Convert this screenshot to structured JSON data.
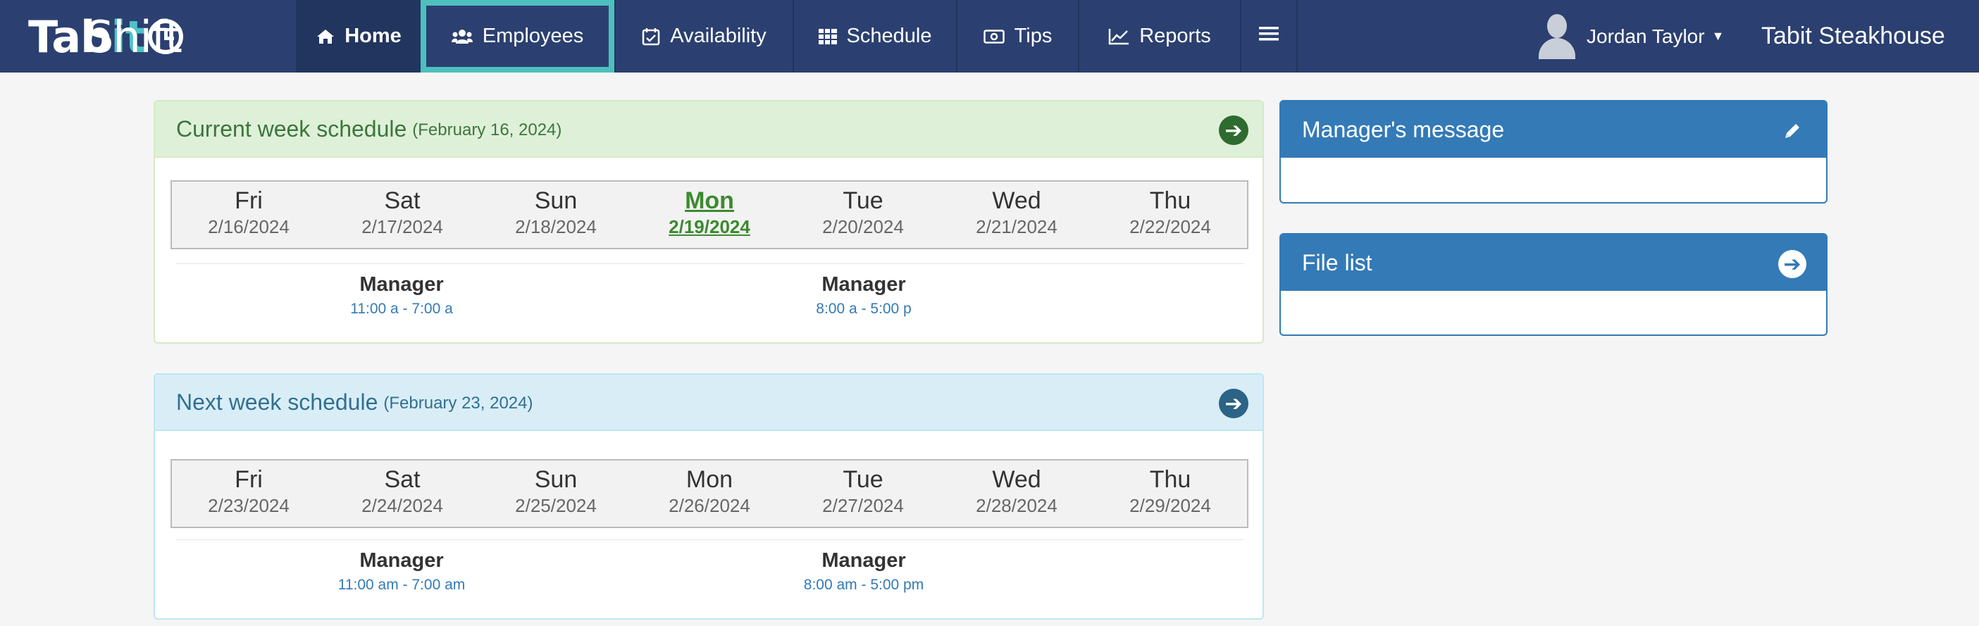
{
  "nav": {
    "logo": {
      "tabit_a": "Tab",
      "tabit_b": "it",
      "shift": "Shift"
    },
    "items": [
      {
        "label": "Home",
        "icon": "home-icon"
      },
      {
        "label": "Employees",
        "icon": "users-icon"
      },
      {
        "label": "Availability",
        "icon": "calendar-check-icon"
      },
      {
        "label": "Schedule",
        "icon": "grid-icon"
      },
      {
        "label": "Tips",
        "icon": "money-icon"
      },
      {
        "label": "Reports",
        "icon": "line-chart-icon"
      }
    ],
    "user_name": "Jordan Taylor",
    "venue": "Tabit Steakhouse"
  },
  "current_week": {
    "title": "Current week schedule",
    "date": "(February 16, 2024)",
    "days": [
      {
        "name": "Fri",
        "date": "2/16/2024"
      },
      {
        "name": "Sat",
        "date": "2/17/2024"
      },
      {
        "name": "Sun",
        "date": "2/18/2024"
      },
      {
        "name": "Mon",
        "date": "2/19/2024"
      },
      {
        "name": "Tue",
        "date": "2/20/2024"
      },
      {
        "name": "Wed",
        "date": "2/21/2024"
      },
      {
        "name": "Thu",
        "date": "2/22/2024"
      }
    ],
    "today_index": 3,
    "shifts": [
      {
        "role": "Manager",
        "time": "11:00 a - 7:00 a"
      },
      {
        "role": "Manager",
        "time": "8:00 a - 5:00 p"
      }
    ]
  },
  "next_week": {
    "title": "Next week schedule",
    "date": "(February 23, 2024)",
    "days": [
      {
        "name": "Fri",
        "date": "2/23/2024"
      },
      {
        "name": "Sat",
        "date": "2/24/2024"
      },
      {
        "name": "Sun",
        "date": "2/25/2024"
      },
      {
        "name": "Mon",
        "date": "2/26/2024"
      },
      {
        "name": "Tue",
        "date": "2/27/2024"
      },
      {
        "name": "Wed",
        "date": "2/28/2024"
      },
      {
        "name": "Thu",
        "date": "2/29/2024"
      }
    ],
    "shifts": [
      {
        "role": "Manager",
        "time": "11:00 am - 7:00 am"
      },
      {
        "role": "Manager",
        "time": "8:00 am - 5:00 pm"
      }
    ]
  },
  "sidebar": {
    "managers_message": "Manager's message",
    "file_list": "File list"
  },
  "colors": {
    "navbar": "#2b4070",
    "highlight": "#4ebfbf",
    "current_accent": "#3c763d",
    "next_accent": "#31708f",
    "side_accent": "#337ab7"
  }
}
